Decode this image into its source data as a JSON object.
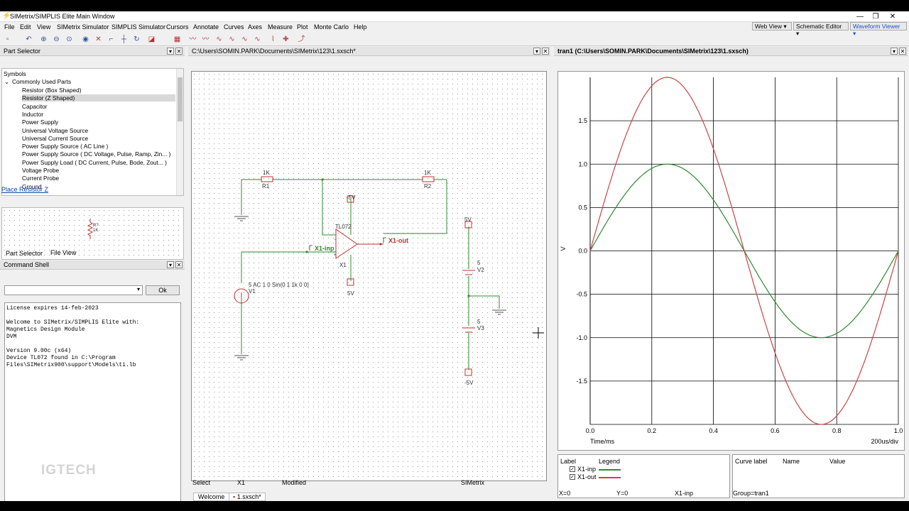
{
  "window": {
    "title": "SIMetrix/SIMPLIS Elite Main Window",
    "min": "—",
    "max": "❐",
    "close": "✕"
  },
  "menu": [
    "File",
    "Edit",
    "View",
    "SIMetrix Simulator",
    "SIMPLIS Simulator",
    "Cursors",
    "Annotate",
    "Curves",
    "Axes",
    "Measure",
    "Plot",
    "Monte Carlo",
    "Help"
  ],
  "views": {
    "web": "Web View",
    "schematic": "Schematic Editor",
    "waveform": "Waveform Viewer"
  },
  "part_selector": {
    "title": "Part Selector",
    "header": "Symbols",
    "category": "Commonly Used Parts",
    "items": [
      "Resistor (Box Shaped)",
      "Resistor (Z Shaped)",
      "Capacitor",
      "Inductor",
      "Power Supply",
      "Universal Voltage Source",
      "Universal Current Source",
      "Power Supply Source ( AC Line )",
      "Power Supply Source ( DC Voltage, Pulse, Ramp, Zin... )",
      "Power Supply Load ( DC Current, Pulse, Bode, Zout... )",
      "Voltage Probe",
      "Current Probe",
      "Ground"
    ],
    "place_link": "Place Resistor Z",
    "preview_ref": "R?",
    "preview_val": "1K",
    "tab_parts": "Part Selector",
    "tab_files": "File View"
  },
  "command_shell": {
    "title": "Command Shell",
    "ok": "Ok",
    "lines": [
      "License expires 14-feb-2023",
      "",
      "Welcome to SIMetrix/SIMPLIS Elite with:",
      "Magnetics Design Module",
      "DVM",
      "",
      "Version 9.00c (x64)",
      "Device TL072 found in C:\\Program",
      "Files\\SIMetrix900\\support\\Models\\ti.lb"
    ],
    "watermark": "IGTECH"
  },
  "schematic": {
    "path": "C:\\Users\\SOMIN.PARK\\Documents\\SIMetrix\\123\\1.sxsch*",
    "r1_val": "1K",
    "r1_ref": "R1",
    "r2_val": "1K",
    "r2_ref": "R2",
    "opamp_model": "TL072",
    "opamp_ref": "X1",
    "vneg_top": "-5V",
    "vpos_bot": "5V",
    "probe_inp": "X1-inp",
    "probe_out": "X1-out",
    "v1_spec": "5 AC 1 0 Sin(0 1 1k 0 0)",
    "v1_ref": "V1",
    "v2_top": "5V",
    "v2_val": "5",
    "v2_ref": "V2",
    "v3_val": "5",
    "v3_ref": "V3",
    "v3_bot": "-5V"
  },
  "waveform": {
    "title": "tran1 (C:\\Users\\SOMIN.PARK\\Documents\\SIMetrix\\123\\1.sxsch)"
  },
  "chart_data": {
    "type": "line",
    "title": "",
    "xlabel": "Time/ms",
    "ylabel": "V",
    "x_scale_note": "200us/div",
    "xlim": [
      0,
      1.0
    ],
    "ylim": [
      -2.0,
      2.0
    ],
    "x_ticks": [
      "0.0",
      "0.2",
      "0.4",
      "0.6",
      "0.8",
      "1.0"
    ],
    "y_ticks": [
      "1.5",
      "1.0",
      "0.5",
      "0.0",
      "-0.5",
      "-1.0",
      "-1.5"
    ],
    "y_tick_values": [
      1.5,
      1.0,
      0.5,
      0.0,
      -0.5,
      -1.0,
      -1.5
    ],
    "grid": true,
    "x": [
      0,
      0.05,
      0.1,
      0.15,
      0.2,
      0.25,
      0.3,
      0.35,
      0.4,
      0.45,
      0.5,
      0.55,
      0.6,
      0.65,
      0.7,
      0.75,
      0.8,
      0.85,
      0.9,
      0.95,
      1.0
    ],
    "series": [
      {
        "name": "X1-inp",
        "color": "#2e8b2e",
        "values": [
          0,
          0.309,
          0.588,
          0.809,
          0.951,
          1.0,
          0.951,
          0.809,
          0.588,
          0.309,
          0,
          -0.309,
          -0.588,
          -0.809,
          -0.951,
          -1.0,
          -0.951,
          -0.809,
          -0.588,
          -0.309,
          0
        ]
      },
      {
        "name": "X1-out",
        "color": "#cc4444",
        "values": [
          0,
          0.618,
          1.176,
          1.618,
          1.902,
          2.0,
          1.902,
          1.618,
          1.176,
          0.618,
          0,
          -0.618,
          -1.176,
          -1.618,
          -1.902,
          -2.0,
          -1.902,
          -1.618,
          -1.176,
          -0.618,
          0
        ]
      }
    ]
  },
  "legend": {
    "col_label": "Label",
    "col_legend": "Legend",
    "cols2": [
      "Curve label",
      "Name",
      "Value"
    ]
  },
  "status_sch": {
    "mode": "Select",
    "sel": "X1",
    "state": "Modified",
    "app": "SIMetrix"
  },
  "doc_tabs": [
    "Welcome",
    "1.sxsch*"
  ],
  "status_wave": {
    "x": "X=0",
    "y": "Y=0",
    "curve": "X1-inp",
    "group": "Group=tran1"
  }
}
